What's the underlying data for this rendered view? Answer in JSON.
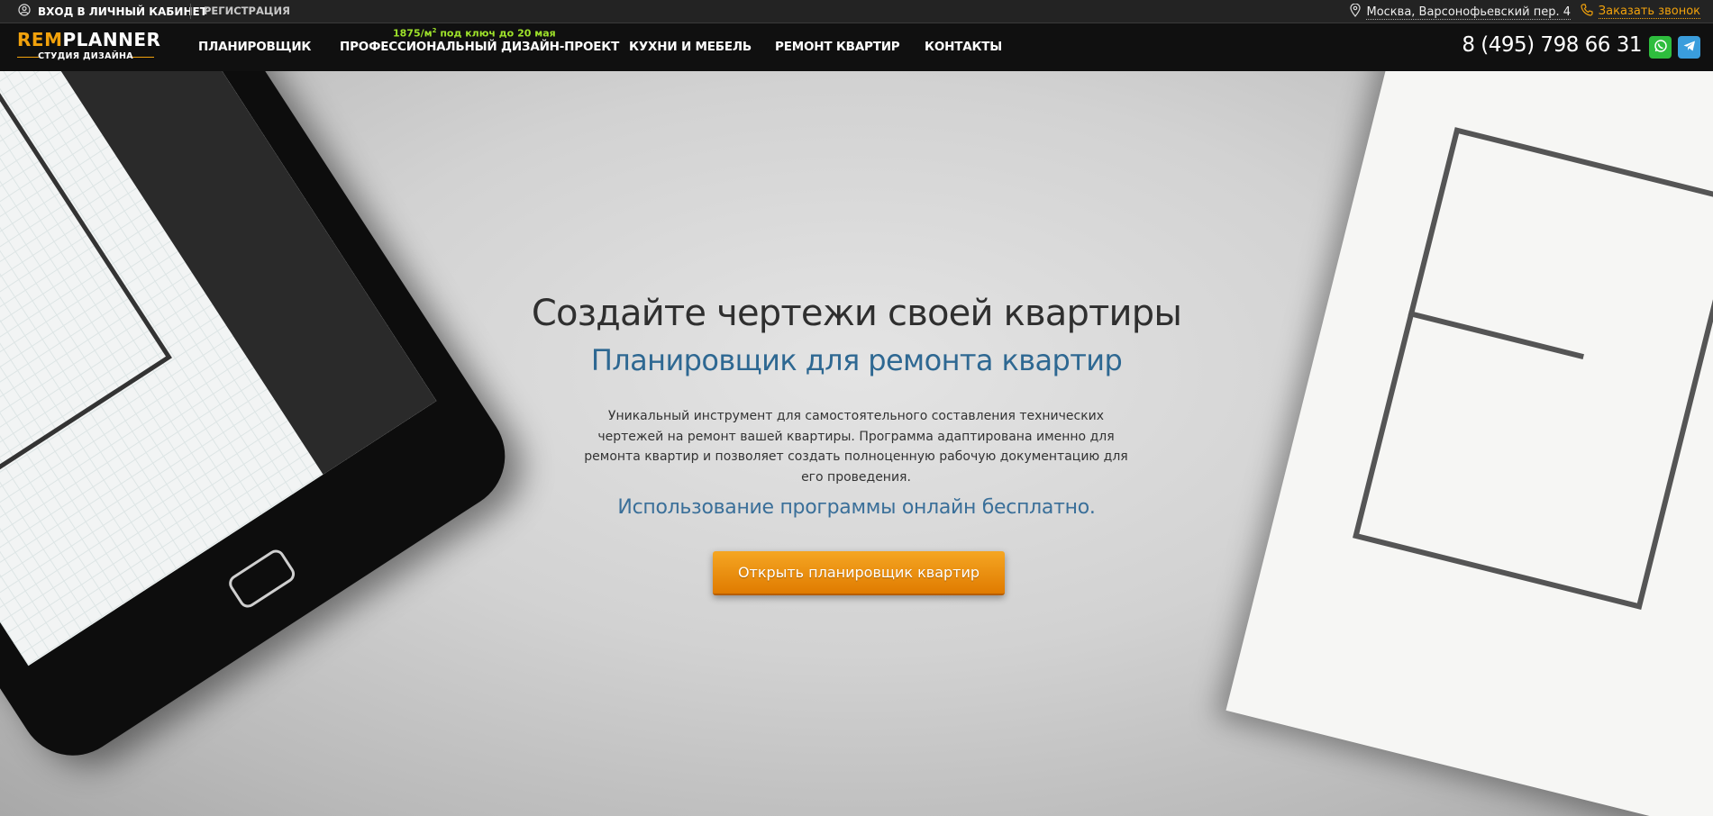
{
  "topbar": {
    "login_label": "ВХОД В ЛИЧНЫЙ КАБИНЕТ",
    "register_label": "РЕГИСТРАЦИЯ",
    "address": "Москва, Варсонофьевский пер. 4",
    "callback_label": "Заказать звонок"
  },
  "navbar": {
    "logo": {
      "brand_rem": "REM",
      "brand_planner": "PLANNER",
      "subtitle": "СТУДИЯ ДИЗАЙНА"
    },
    "promo_price": "1875/м",
    "promo_sup": "2",
    "promo_text": " под ключ до 20 мая",
    "items": [
      {
        "label": "ПЛАНИРОВЩИК"
      },
      {
        "label": "ПРОФЕССИОНАЛЬНЫЙ ДИЗАЙН-ПРОЕКТ"
      },
      {
        "label": "КУХНИ И МЕБЕЛЬ"
      },
      {
        "label": "РЕМОНТ КВАРТИР"
      },
      {
        "label": "КОНТАКТЫ"
      }
    ],
    "phone": "8 (495) 798 66 31"
  },
  "hero": {
    "title": "Создайте чертежи своей квартиры",
    "subtitle": "Планировщик для ремонта квартир",
    "description": "Уникальный инструмент для самостоятельного составления технических чертежей на ремонт вашей квартиры. Программа адаптирована именно для ремонта квартир и позволяет создать полноценную рабочую документацию для его проведения.",
    "free_note": "Использование программы онлайн бесплатно.",
    "cta_label": "Открыть планировщик квартир"
  },
  "icons": [
    "user-icon",
    "location-pin-icon",
    "phone-handset-icon",
    "whatsapp-icon",
    "telegram-icon"
  ],
  "colors": {
    "accent": "#f2a20c",
    "promo": "#9ee22a",
    "heading_blue": "#2e6892",
    "whatsapp": "#2ebd3d",
    "telegram": "#3a9ddc"
  }
}
